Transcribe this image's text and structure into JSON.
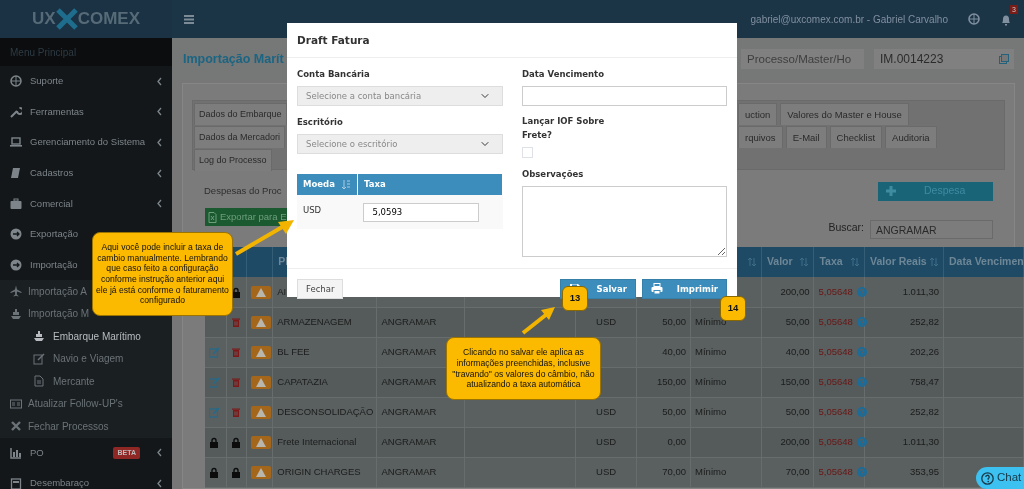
{
  "header": {
    "logo_left": "UX",
    "logo_right": "COMEX",
    "user": "gabriel@uxcomex.com.br - Gabriel Carvalho",
    "notifications": "3"
  },
  "sidebar": {
    "heading": "Menu Principal",
    "items": [
      {
        "label": "Suporte",
        "kind": "group",
        "has_submenu": true,
        "selected": false
      },
      {
        "label": "Ferramentas",
        "kind": "group",
        "has_submenu": true,
        "selected": false
      },
      {
        "label": "Gerenciamento do Sistema",
        "kind": "group",
        "has_submenu": true,
        "selected": false
      },
      {
        "label": "Cadastros",
        "kind": "group",
        "has_submenu": true,
        "selected": false
      },
      {
        "label": "Comercial",
        "kind": "group",
        "has_submenu": true,
        "selected": false
      },
      {
        "label": "Exportação",
        "kind": "group",
        "selected": false
      },
      {
        "label": "Importação",
        "kind": "group",
        "selected": false
      },
      {
        "label": "Importação A",
        "kind": "sub",
        "selected": false
      },
      {
        "label": "Importação M",
        "kind": "sub",
        "selected": false
      },
      {
        "label": "Embarque Marítimo",
        "kind": "subsub",
        "has_submenu": false,
        "selected": true
      },
      {
        "label": "Navio e Viagem",
        "kind": "subsub",
        "has_submenu": false,
        "selected": false
      },
      {
        "label": "Mercante",
        "kind": "subsub",
        "has_submenu": false,
        "selected": false
      },
      {
        "label": "Atualizar Follow-UP's",
        "kind": "sub",
        "has_submenu": false,
        "selected": false
      },
      {
        "label": "Fechar Processos",
        "kind": "sub",
        "has_submenu": false,
        "selected": false
      },
      {
        "label": "PO",
        "kind": "group",
        "has_submenu": true,
        "selected": false,
        "badge": "BETA"
      },
      {
        "label": "Desembaraço",
        "kind": "group",
        "has_submenu": true,
        "selected": false
      }
    ]
  },
  "page": {
    "title": "Importação Marít",
    "process_field": {
      "placeholder": "Processo/Master/Ho"
    },
    "process_value": "IM.0014223",
    "tab_rows": [
      [
        {
          "label": "Dados do Embarque",
          "selected": false
        },
        {
          "label": "uction",
          "selected": false
        },
        {
          "label": "Valores do Master e House",
          "selected": false
        }
      ],
      [
        {
          "label": "Dados da Mercadori",
          "selected": false
        },
        {
          "label": "rquivos",
          "selected": false
        },
        {
          "label": "E-Mail",
          "selected": false
        },
        {
          "label": "Checklist",
          "selected": false
        },
        {
          "label": "Auditoria",
          "selected": false
        }
      ],
      [
        {
          "label": "Log do Processo",
          "selected": false
        }
      ]
    ],
    "section_title": "Despesas do Proc",
    "export_button": "Exportar para E",
    "add_button": "Despesa",
    "search_label": "Buscar:",
    "search_value": "ANGRAMAR"
  },
  "table": {
    "columns": [
      {
        "label": "Pl"
      },
      {
        "sortable": true
      },
      {
        "label": "Valor",
        "sortable": true
      },
      {
        "label": "Taxa",
        "sortable": true
      },
      {
        "label": "Valor Reais",
        "sortable": true
      },
      {
        "label": "Data Vencimen"
      }
    ],
    "rows": [
      {
        "action_2": {
          "kind": "lock"
        },
        "name": "AI",
        "value": "200,00",
        "rate": "5,05648",
        "value_brl": "1.011,30"
      },
      {
        "action_2": {
          "kind": "trash"
        },
        "name": "ARMAZENAGEM",
        "supplier": "ANGRAMAR",
        "currency": "USD",
        "amount": "50,00",
        "basis": "Mínimo",
        "value": "50,00",
        "rate": "5,05648",
        "value_brl": "252,82"
      },
      {
        "action_1": {
          "kind": "edit"
        },
        "action_2": {
          "kind": "trash"
        },
        "name": "BL FEE",
        "supplier": "ANGRAMAR",
        "amount": "40,00",
        "basis": "Mínimo",
        "value": "40,00",
        "rate": "5,05648",
        "value_brl": "202,26"
      },
      {
        "action_1": {
          "kind": "edit"
        },
        "action_2": {
          "kind": "trash"
        },
        "name": "CAPATAZIA",
        "supplier": "ANGRAMAR",
        "amount": "150,00",
        "basis": "Mínimo",
        "value": "150,00",
        "rate": "5,05648",
        "value_brl": "758,47"
      },
      {
        "action_1": {
          "kind": "edit"
        },
        "action_2": {
          "kind": "trash"
        },
        "name": "DESCONSOLIDAÇÃO",
        "supplier": "ANGRAMAR",
        "currency": "USD",
        "amount": "50,00",
        "basis": "Mínimo",
        "value": "50,00",
        "rate": "5,05648",
        "value_brl": "252,82"
      },
      {
        "action_1": {
          "kind": "lock"
        },
        "action_2": {
          "kind": "lock"
        },
        "name": "Frete Internacional",
        "supplier": "ANGRAMAR",
        "currency": "USD",
        "amount": "0,00",
        "value": "200,00",
        "rate": "5,05648",
        "value_brl": "1.011,30"
      },
      {
        "action_1": {
          "kind": "lock"
        },
        "action_2": {
          "kind": "lock"
        },
        "name": "ORIGIN CHARGES",
        "supplier": "ANGRAMAR",
        "currency": "USD",
        "amount": "70,00",
        "basis": "Mínimo",
        "value": "70,00",
        "rate": "5,05648",
        "value_brl": "353,95"
      }
    ]
  },
  "modal": {
    "title": "Draft Fatura",
    "bank_label": "Conta Bancária",
    "bank_select": {
      "placeholder": "Selecione a conta bancária"
    },
    "office_label": "Escritório",
    "office_select": {
      "placeholder": "Selecione o escritório"
    },
    "due_label": "Data Vencimento",
    "iof_label": "Lançar IOF Sobre Frete?",
    "iof_checked": false,
    "rate_table": {
      "columns": [
        "Moeda",
        "Taxa"
      ],
      "rows": [
        {
          "currency": "USD",
          "rate": "5,0593"
        }
      ]
    },
    "notes_label": "Observações",
    "close_button": "Fechar",
    "save_button": "Salvar",
    "print_button": "Imprimir"
  },
  "callouts": [
    "Aqui você pode incluir a taxa de cambio manualmente. Lembrando que caso feito a configuração conforme instrução anterior aqui ele já está conforme o faturamento configurado",
    "Clicando no salvar ele aplica as informações preenchidas, inclusive \"travando\" os valores do câmbio, não atualizando a taxa automática"
  ],
  "steps": [
    "13",
    "14"
  ],
  "chat_button": "Chat"
}
